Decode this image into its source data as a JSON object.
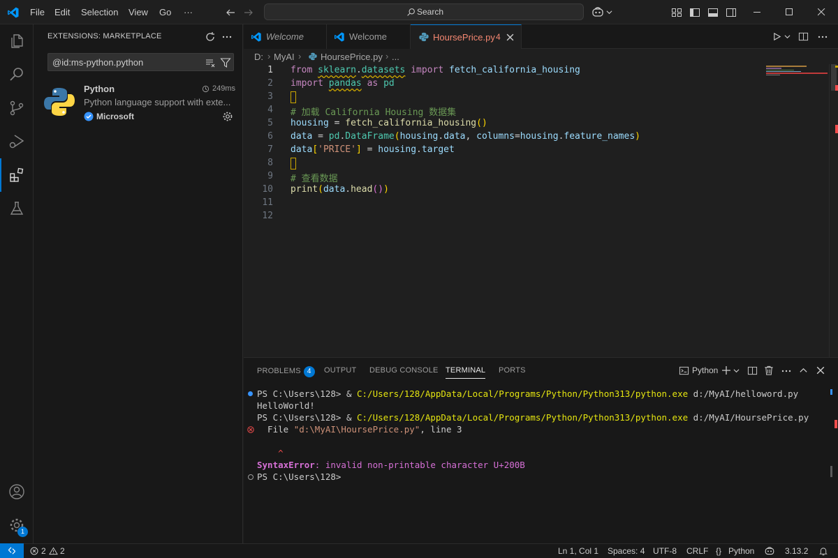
{
  "menu": {
    "file": "File",
    "edit": "Edit",
    "selection": "Selection",
    "view": "View",
    "go": "Go",
    "more": "···"
  },
  "search": {
    "label": "Search"
  },
  "sidebar": {
    "title": "EXTENSIONS: MARKETPLACE",
    "search_value": "@id:ms-python.python",
    "extension": {
      "name": "Python",
      "time": "249ms",
      "description": "Python language support with exte...",
      "publisher": "Microsoft"
    }
  },
  "activity": {
    "settings_badge": "1"
  },
  "tabs": [
    {
      "label": "Welcome"
    },
    {
      "label": "Welcome"
    },
    {
      "label": "HoursePrice.py",
      "problems": "4"
    }
  ],
  "breadcrumb": {
    "drive": "D:",
    "folder": "MyAI",
    "file": "HoursePrice.py",
    "more": "..."
  },
  "editor": {
    "line_numbers": [
      "1",
      "2",
      "3",
      "4",
      "5",
      "6",
      "7",
      "8",
      "9",
      "10",
      "11",
      "12"
    ],
    "lines": [
      "from sklearn.datasets import fetch_california_housing",
      "import pandas as pd",
      "",
      "# 加载 California Housing 数据集",
      "housing = fetch_california_housing()",
      "data = pd.DataFrame(housing.data, columns=housing.feature_names)",
      "data['PRICE'] = housing.target",
      "",
      "# 查看数据",
      "print(data.head())",
      "",
      ""
    ]
  },
  "panel": {
    "tabs": {
      "problems": "PROBLEMS",
      "problems_count": "4",
      "output": "OUTPUT",
      "debug": "DEBUG CONSOLE",
      "terminal": "TERMINAL",
      "ports": "PORTS"
    },
    "terminal_name": "Python",
    "terminal": {
      "prompt1": "PS C:\\Users\\128> ",
      "amp1": "& ",
      "exe1": "C:/Users/128/AppData/Local/Programs/Python/Python313/python.exe",
      "arg1": " d:/MyAI/helloword.py",
      "out1": "HelloWorld!",
      "prompt2": "PS C:\\Users\\128> ",
      "amp2": "& ",
      "exe2": "C:/Users/128/AppData/Local/Programs/Python/Python313/python.exe",
      "arg2": " d:/MyAI/HoursePrice.py",
      "file_pre": "  File ",
      "file_path": "\"d:\\MyAI\\HoursePrice.py\"",
      "file_post": ", line 3",
      "caret": "    ^",
      "err_type": "SyntaxError",
      "err_msg": ": invalid non-printable character U+200B",
      "prompt3": "PS C:\\Users\\128>"
    }
  },
  "status": {
    "errors": "2",
    "warnings": "2",
    "position": "Ln 1, Col 1",
    "spaces": "Spaces: 4",
    "encoding": "UTF-8",
    "eol": "CRLF",
    "language": "Python",
    "version": "3.13.2"
  },
  "colors": {
    "accent": "#0078d4",
    "tab_modified": "#f48771",
    "error": "#f14c4c",
    "warning": "#cca700"
  }
}
